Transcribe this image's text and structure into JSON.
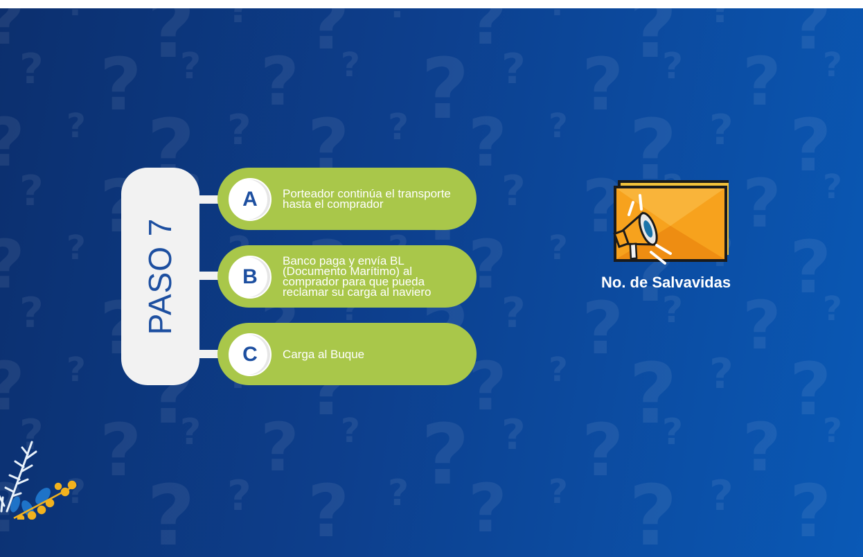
{
  "paso": {
    "title": "PASO 7"
  },
  "options": [
    {
      "letter": "A",
      "text": "Porteador continúa el transporte hasta el comprador"
    },
    {
      "letter": "B",
      "text": "Banco paga y envía BL (Documento Marítimo) al comprador para que pueda reclamar su carga al naviero"
    },
    {
      "letter": "C",
      "text": "Carga al Buque"
    }
  ],
  "lifebuoys": {
    "label": "No. de Salvavidas",
    "icon": "megaphone-icon"
  },
  "colors": {
    "background": "#0d3f8d",
    "option_fill": "#a9c74a",
    "badge_text": "#1d4fa0",
    "card": "#f2f2f2",
    "folder": "#f7a21d"
  }
}
